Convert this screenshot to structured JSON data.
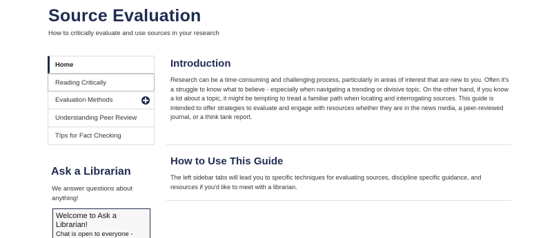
{
  "header": {
    "title": "Source Evaluation",
    "subtitle": "How to critically evaluate and use sources in your research"
  },
  "sidebar": {
    "items": [
      {
        "label": "Home"
      },
      {
        "label": "Reading Critically"
      },
      {
        "label": "Evaluation Methods",
        "icon": "plus-circle-icon"
      },
      {
        "label": "Understanding Peer Review"
      },
      {
        "label": "TIps for Fact Checking"
      }
    ]
  },
  "ask_librarian": {
    "heading": "Ask a Librarian",
    "text": "We answer questions about anything!",
    "chat_title": "Welcome to Ask a Librarian!",
    "chat_status": "Chat is open to everyone -"
  },
  "main": {
    "sections": [
      {
        "heading": "Introduction",
        "body": "Research can be a time-consuming and challenging process, particularly in areas of interest that are new to you. Often it's a struggle to know what to believe - especially when navigating a trending or divisive topic. On the other hand, if you know a lot about a topic, it might be tempting to tread a familiar path when locating and interrogating sources. This guide is intended to offer strategies to evaluate and engage with resources whether they are in the news media, a peer-reviewed journal, or a think tank report."
      },
      {
        "heading": "How to Use This Guide",
        "body": "The left sidebar tabs will lead you to specific techniques for evaluating sources, discipline specific guidance, and resources if you'd like to meet with a librarian."
      }
    ]
  },
  "colors": {
    "accent": "#1f2c4f",
    "text": "#333333",
    "border": "#dcdcdc"
  }
}
